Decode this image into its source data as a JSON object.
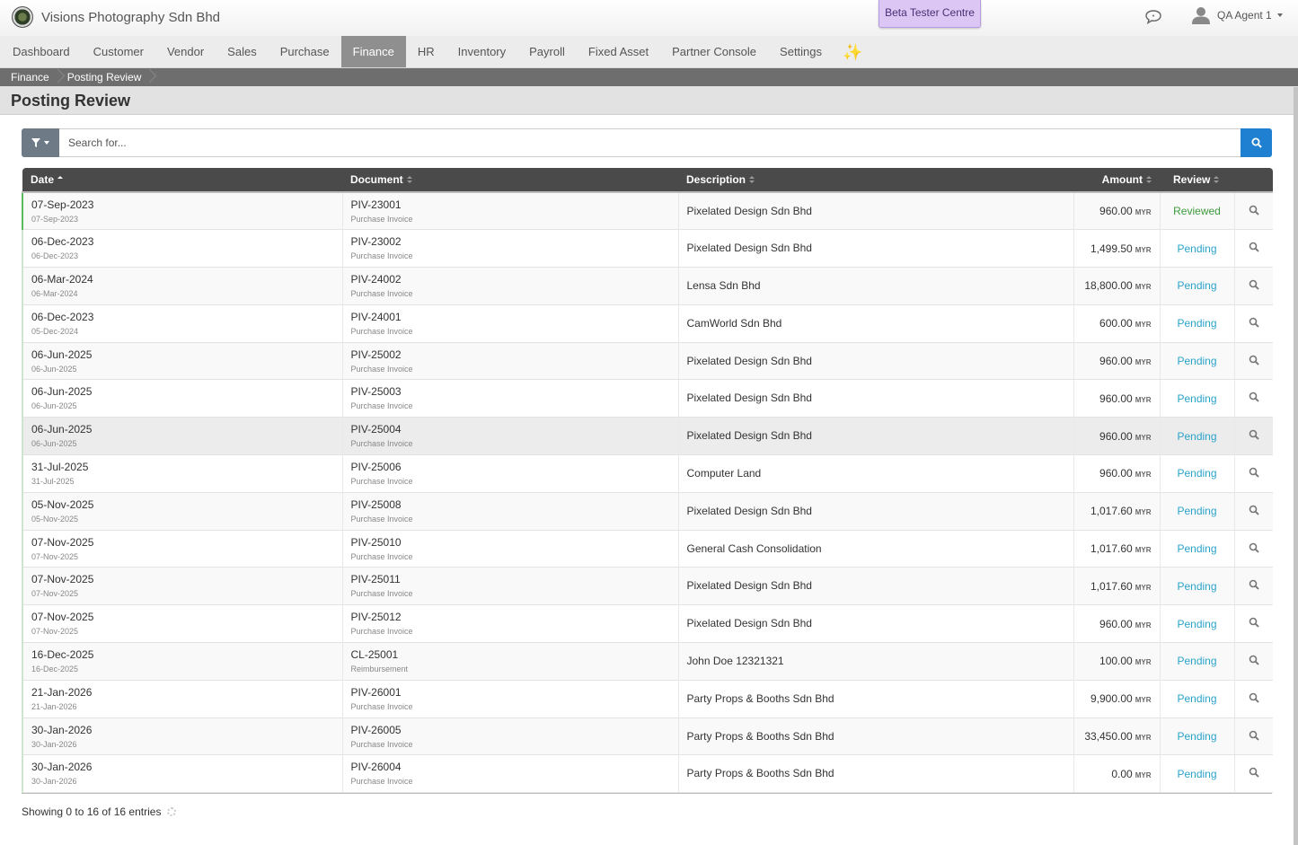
{
  "header": {
    "company": "Visions Photography Sdn Bhd",
    "beta_label": "Beta Tester Centre",
    "user_name": "QA Agent 1"
  },
  "nav": {
    "items": [
      {
        "label": "Dashboard"
      },
      {
        "label": "Customer"
      },
      {
        "label": "Vendor"
      },
      {
        "label": "Sales"
      },
      {
        "label": "Purchase"
      },
      {
        "label": "Finance"
      },
      {
        "label": "HR"
      },
      {
        "label": "Inventory"
      },
      {
        "label": "Payroll"
      },
      {
        "label": "Fixed Asset"
      },
      {
        "label": "Partner Console"
      },
      {
        "label": "Settings"
      }
    ],
    "active": "Finance",
    "sparkle": "✨"
  },
  "breadcrumb": [
    "Finance",
    "Posting Review"
  ],
  "page_title": "Posting Review",
  "search": {
    "placeholder": "Search for..."
  },
  "table": {
    "columns": [
      "Date",
      "Document",
      "Description",
      "Amount",
      "Review"
    ],
    "currency": "MYR",
    "rows": [
      {
        "date": "07-Sep-2023",
        "sub_date": "07-Sep-2023",
        "doc": "PIV-23001",
        "doc_type": "Purchase Invoice",
        "desc": "Pixelated Design Sdn Bhd",
        "amount": "960.00",
        "review": "Reviewed"
      },
      {
        "date": "06-Dec-2023",
        "sub_date": "06-Dec-2023",
        "doc": "PIV-23002",
        "doc_type": "Purchase Invoice",
        "desc": "Pixelated Design Sdn Bhd",
        "amount": "1,499.50",
        "review": "Pending"
      },
      {
        "date": "06-Mar-2024",
        "sub_date": "06-Mar-2024",
        "doc": "PIV-24002",
        "doc_type": "Purchase Invoice",
        "desc": "Lensa Sdn Bhd",
        "amount": "18,800.00",
        "review": "Pending"
      },
      {
        "date": "06-Dec-2023",
        "sub_date": "05-Dec-2024",
        "doc": "PIV-24001",
        "doc_type": "Purchase Invoice",
        "desc": "CamWorld Sdn Bhd",
        "amount": "600.00",
        "review": "Pending"
      },
      {
        "date": "06-Jun-2025",
        "sub_date": "06-Jun-2025",
        "doc": "PIV-25002",
        "doc_type": "Purchase Invoice",
        "desc": "Pixelated Design Sdn Bhd",
        "amount": "960.00",
        "review": "Pending"
      },
      {
        "date": "06-Jun-2025",
        "sub_date": "06-Jun-2025",
        "doc": "PIV-25003",
        "doc_type": "Purchase Invoice",
        "desc": "Pixelated Design Sdn Bhd",
        "amount": "960.00",
        "review": "Pending"
      },
      {
        "date": "06-Jun-2025",
        "sub_date": "06-Jun-2025",
        "doc": "PIV-25004",
        "doc_type": "Purchase Invoice",
        "desc": "Pixelated Design Sdn Bhd",
        "amount": "960.00",
        "review": "Pending"
      },
      {
        "date": "31-Jul-2025",
        "sub_date": "31-Jul-2025",
        "doc": "PIV-25006",
        "doc_type": "Purchase Invoice",
        "desc": "Computer Land",
        "amount": "960.00",
        "review": "Pending"
      },
      {
        "date": "05-Nov-2025",
        "sub_date": "05-Nov-2025",
        "doc": "PIV-25008",
        "doc_type": "Purchase Invoice",
        "desc": "Pixelated Design Sdn Bhd",
        "amount": "1,017.60",
        "review": "Pending"
      },
      {
        "date": "07-Nov-2025",
        "sub_date": "07-Nov-2025",
        "doc": "PIV-25010",
        "doc_type": "Purchase Invoice",
        "desc": "General Cash Consolidation",
        "amount": "1,017.60",
        "review": "Pending"
      },
      {
        "date": "07-Nov-2025",
        "sub_date": "07-Nov-2025",
        "doc": "PIV-25011",
        "doc_type": "Purchase Invoice",
        "desc": "Pixelated Design Sdn Bhd",
        "amount": "1,017.60",
        "review": "Pending"
      },
      {
        "date": "07-Nov-2025",
        "sub_date": "07-Nov-2025",
        "doc": "PIV-25012",
        "doc_type": "Purchase Invoice",
        "desc": "Pixelated Design Sdn Bhd",
        "amount": "960.00",
        "review": "Pending"
      },
      {
        "date": "16-Dec-2025",
        "sub_date": "16-Dec-2025",
        "doc": "CL-25001",
        "doc_type": "Reimbursement",
        "desc": "John Doe 12321321",
        "amount": "100.00",
        "review": "Pending"
      },
      {
        "date": "21-Jan-2026",
        "sub_date": "21-Jan-2026",
        "doc": "PIV-26001",
        "doc_type": "Purchase Invoice",
        "desc": "Party Props & Booths Sdn Bhd",
        "amount": "9,900.00",
        "review": "Pending"
      },
      {
        "date": "30-Jan-2026",
        "sub_date": "30-Jan-2026",
        "doc": "PIV-26005",
        "doc_type": "Purchase Invoice",
        "desc": "Party Props & Booths Sdn Bhd",
        "amount": "33,450.00",
        "review": "Pending"
      },
      {
        "date": "30-Jan-2026",
        "sub_date": "30-Jan-2026",
        "doc": "PIV-26004",
        "doc_type": "Purchase Invoice",
        "desc": "Party Props & Booths Sdn Bhd",
        "amount": "0.00",
        "review": "Pending"
      }
    ]
  },
  "footer": {
    "info": "Showing 0 to 16 of 16 entries"
  },
  "colors": {
    "accent": "#1f7fd1",
    "pending": "#2aa3c9",
    "reviewed": "#3c9a3c",
    "nav_active": "#8f8f8f"
  }
}
